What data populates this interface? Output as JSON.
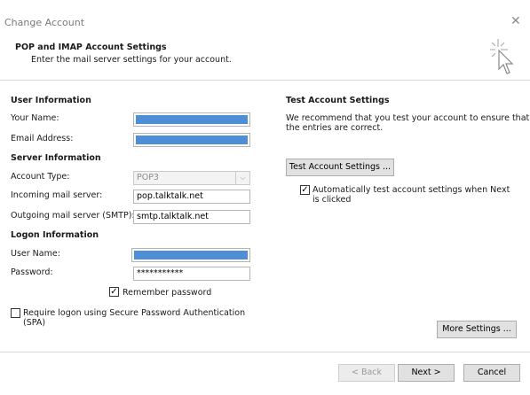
{
  "window": {
    "title": "Change Account"
  },
  "header": {
    "title": "POP and IMAP Account Settings",
    "subtitle": "Enter the mail server settings for your account."
  },
  "user_info": {
    "section_label": "User Information",
    "name_label": "Your Name:",
    "email_label": "Email Address:"
  },
  "server_info": {
    "section_label": "Server Information",
    "account_type_label": "Account Type:",
    "account_type_value": "POP3",
    "incoming_label": "Incoming mail server:",
    "incoming_value": "pop.talktalk.net",
    "outgoing_label": "Outgoing mail server (SMTP):",
    "outgoing_value": "smtp.talktalk.net"
  },
  "logon_info": {
    "section_label": "Logon Information",
    "username_label": "User Name:",
    "password_label": "Password:",
    "password_value": "***********",
    "remember_label": "Remember password",
    "remember_checked": true,
    "spa_label_line1": "Require logon using Secure Password Authentication",
    "spa_label_line2": "(SPA)",
    "spa_checked": false
  },
  "test_settings": {
    "section_label": "Test Account Settings",
    "description_line1": "We recommend that you test your account to ensure that",
    "description_line2": "the entries are correct.",
    "test_button": "Test Account Settings ...",
    "auto_test_line1": "Automatically test account settings when Next",
    "auto_test_line2": "is clicked",
    "auto_test_checked": true
  },
  "buttons": {
    "more_settings": "More Settings ...",
    "back": "< Back",
    "next": "Next >",
    "cancel": "Cancel"
  },
  "colors": {
    "redaction": "#4c8fd6",
    "title_text": "#7a7a7a"
  },
  "icons": {
    "close": "close-icon",
    "cursor": "cursor-click-icon",
    "check": "checkmark-icon",
    "dropdown": "chevron-down-icon"
  }
}
